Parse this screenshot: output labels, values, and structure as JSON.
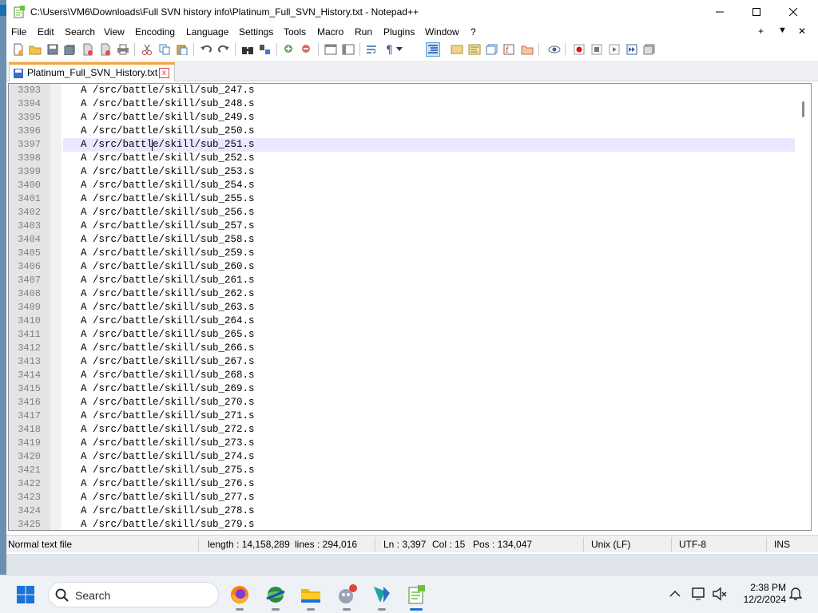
{
  "window": {
    "title": "C:\\Users\\VM6\\Downloads\\Full SVN history info\\Platinum_Full_SVN_History.txt - Notepad++"
  },
  "menu": [
    "File",
    "Edit",
    "Search",
    "View",
    "Encoding",
    "Language",
    "Settings",
    "Tools",
    "Macro",
    "Run",
    "Plugins",
    "Window",
    "?"
  ],
  "menu_right": {
    "add": "+",
    "dropdown": "▼",
    "close": "✕"
  },
  "toolbar": [
    "new-file",
    "open-file",
    "save",
    "save-all",
    "close",
    "close-all",
    "print",
    "cut",
    "copy",
    "paste",
    "undo",
    "redo",
    "find",
    "replace",
    "zoom-in",
    "zoom-out",
    "sync-vertical",
    "sync-horizontal",
    "word-wrap",
    "show-all-characters",
    "indent-guide",
    "user-defined-language",
    "document-map",
    "function-list",
    "folder-as-workspace",
    "monitoring",
    "record-macro",
    "stop-macro",
    "play-macro",
    "run-macro-multiple",
    "save-macro"
  ],
  "tab": {
    "label": "Platinum_Full_SVN_History.txt",
    "close": "x"
  },
  "editor": {
    "current_line": 3397,
    "lines": [
      {
        "num": "3393",
        "text": "A /src/battle/skill/sub_247.s"
      },
      {
        "num": "3394",
        "text": "A /src/battle/skill/sub_248.s"
      },
      {
        "num": "3395",
        "text": "A /src/battle/skill/sub_249.s"
      },
      {
        "num": "3396",
        "text": "A /src/battle/skill/sub_250.s"
      },
      {
        "num": "3397",
        "text": "A /src/battle/skill/sub_251.s"
      },
      {
        "num": "3398",
        "text": "A /src/battle/skill/sub_252.s"
      },
      {
        "num": "3399",
        "text": "A /src/battle/skill/sub_253.s"
      },
      {
        "num": "3400",
        "text": "A /src/battle/skill/sub_254.s"
      },
      {
        "num": "3401",
        "text": "A /src/battle/skill/sub_255.s"
      },
      {
        "num": "3402",
        "text": "A /src/battle/skill/sub_256.s"
      },
      {
        "num": "3403",
        "text": "A /src/battle/skill/sub_257.s"
      },
      {
        "num": "3404",
        "text": "A /src/battle/skill/sub_258.s"
      },
      {
        "num": "3405",
        "text": "A /src/battle/skill/sub_259.s"
      },
      {
        "num": "3406",
        "text": "A /src/battle/skill/sub_260.s"
      },
      {
        "num": "3407",
        "text": "A /src/battle/skill/sub_261.s"
      },
      {
        "num": "3408",
        "text": "A /src/battle/skill/sub_262.s"
      },
      {
        "num": "3409",
        "text": "A /src/battle/skill/sub_263.s"
      },
      {
        "num": "3410",
        "text": "A /src/battle/skill/sub_264.s"
      },
      {
        "num": "3411",
        "text": "A /src/battle/skill/sub_265.s"
      },
      {
        "num": "3412",
        "text": "A /src/battle/skill/sub_266.s"
      },
      {
        "num": "3413",
        "text": "A /src/battle/skill/sub_267.s"
      },
      {
        "num": "3414",
        "text": "A /src/battle/skill/sub_268.s"
      },
      {
        "num": "3415",
        "text": "A /src/battle/skill/sub_269.s"
      },
      {
        "num": "3416",
        "text": "A /src/battle/skill/sub_270.s"
      },
      {
        "num": "3417",
        "text": "A /src/battle/skill/sub_271.s"
      },
      {
        "num": "3418",
        "text": "A /src/battle/skill/sub_272.s"
      },
      {
        "num": "3419",
        "text": "A /src/battle/skill/sub_273.s"
      },
      {
        "num": "3420",
        "text": "A /src/battle/skill/sub_274.s"
      },
      {
        "num": "3421",
        "text": "A /src/battle/skill/sub_275.s"
      },
      {
        "num": "3422",
        "text": "A /src/battle/skill/sub_276.s"
      },
      {
        "num": "3423",
        "text": "A /src/battle/skill/sub_277.s"
      },
      {
        "num": "3424",
        "text": "A /src/battle/skill/sub_278.s"
      },
      {
        "num": "3425",
        "text": "A /src/battle/skill/sub_279.s"
      }
    ]
  },
  "status": {
    "file_type": "Normal text file",
    "length": "length : 14,158,289",
    "lines": "lines : 294,016",
    "ln": "Ln : 3,397",
    "col": "Col : 15",
    "pos": "Pos : 134,047",
    "eol": "Unix (LF)",
    "encoding": "UTF-8",
    "mode": "INS"
  },
  "taskbar": {
    "search_label": "Search",
    "apps": [
      "firefox-icon",
      "chrome-like-browser-icon",
      "file-explorer-icon",
      "game-app-icon",
      "vs-code-like-icon",
      "notepad-plus-plus-icon"
    ],
    "time": "2:38 PM",
    "date": "12/2/2024"
  },
  "colors": {
    "current_line": "#e8e8ff",
    "tab_accent": "#f8a23b",
    "taskbar_active": "#1a73d6"
  }
}
